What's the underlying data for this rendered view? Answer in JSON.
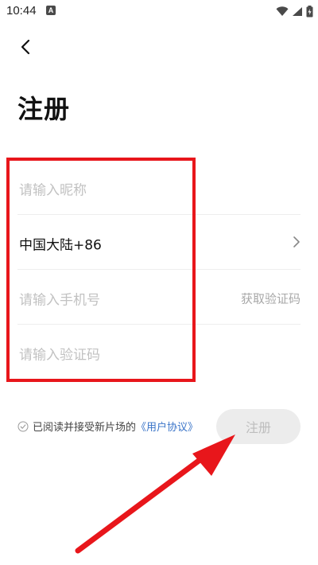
{
  "status_bar": {
    "time": "10:44",
    "notification_letter": "A"
  },
  "page": {
    "title": "注册"
  },
  "form": {
    "nickname_placeholder": "请输入昵称",
    "region": "中国大陆+86",
    "phone_placeholder": "请输入手机号",
    "get_code_label": "获取验证码",
    "code_placeholder": "请输入验证码"
  },
  "agreement": {
    "text": "已阅读并接受新片场的",
    "link": "《用户协议》"
  },
  "actions": {
    "register_label": "注册"
  },
  "colors": {
    "highlight": "#e8161b",
    "link": "#3a74c8",
    "button_disabled_bg": "#ececec"
  }
}
